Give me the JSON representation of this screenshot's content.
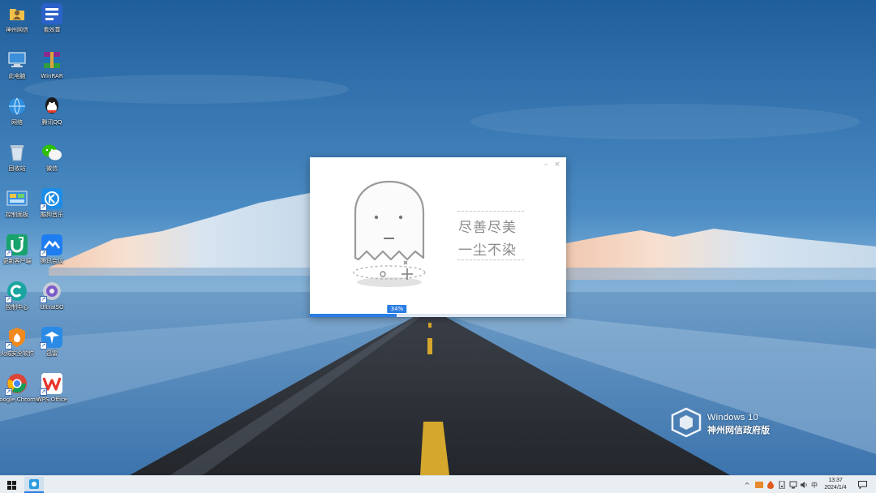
{
  "desktop": {
    "icons": [
      {
        "label": "神州网信",
        "icon": "user-folder-icon"
      },
      {
        "label": "看效菁",
        "icon": "blue-app-icon"
      },
      {
        "label": "此电脑",
        "icon": "computer-icon"
      },
      {
        "label": "WinRAR",
        "icon": "winrar-icon"
      },
      {
        "label": "网络",
        "icon": "network-icon"
      },
      {
        "label": "腾讯QQ",
        "icon": "qq-icon"
      },
      {
        "label": "回收站",
        "icon": "recycle-bin-icon"
      },
      {
        "label": "微信",
        "icon": "wechat-icon"
      },
      {
        "label": "控制面板",
        "icon": "control-panel-icon"
      },
      {
        "label": "酷狗音乐",
        "icon": "kugou-icon"
      },
      {
        "label": "更新客户端",
        "icon": "update-client-icon"
      },
      {
        "label": "腾讯会议",
        "icon": "tencent-meeting-icon"
      },
      {
        "label": "控制中心",
        "icon": "control-center-icon"
      },
      {
        "label": "UltraISO",
        "icon": "ultraiso-icon"
      },
      {
        "label": "火绒安全软件",
        "icon": "huorong-icon"
      },
      {
        "label": "迅雷",
        "icon": "xunlei-icon"
      },
      {
        "label": "Google Chrome",
        "icon": "chrome-icon"
      },
      {
        "label": "WPS Office",
        "icon": "wps-icon"
      }
    ]
  },
  "watermark": {
    "line1": "Windows 10",
    "line2": "神州网信政府版"
  },
  "dialog": {
    "slogan_line1": "尽善尽美",
    "slogan_line2": "一尘不染",
    "minimize_symbol": "–",
    "close_symbol": "×",
    "progress": 34,
    "progress_label": "34%",
    "accent": "#2b7de3"
  },
  "taskbar": {
    "tray": {
      "chevron": "^",
      "ime": "中",
      "time": "13:37",
      "date": "2024/1/4"
    }
  }
}
